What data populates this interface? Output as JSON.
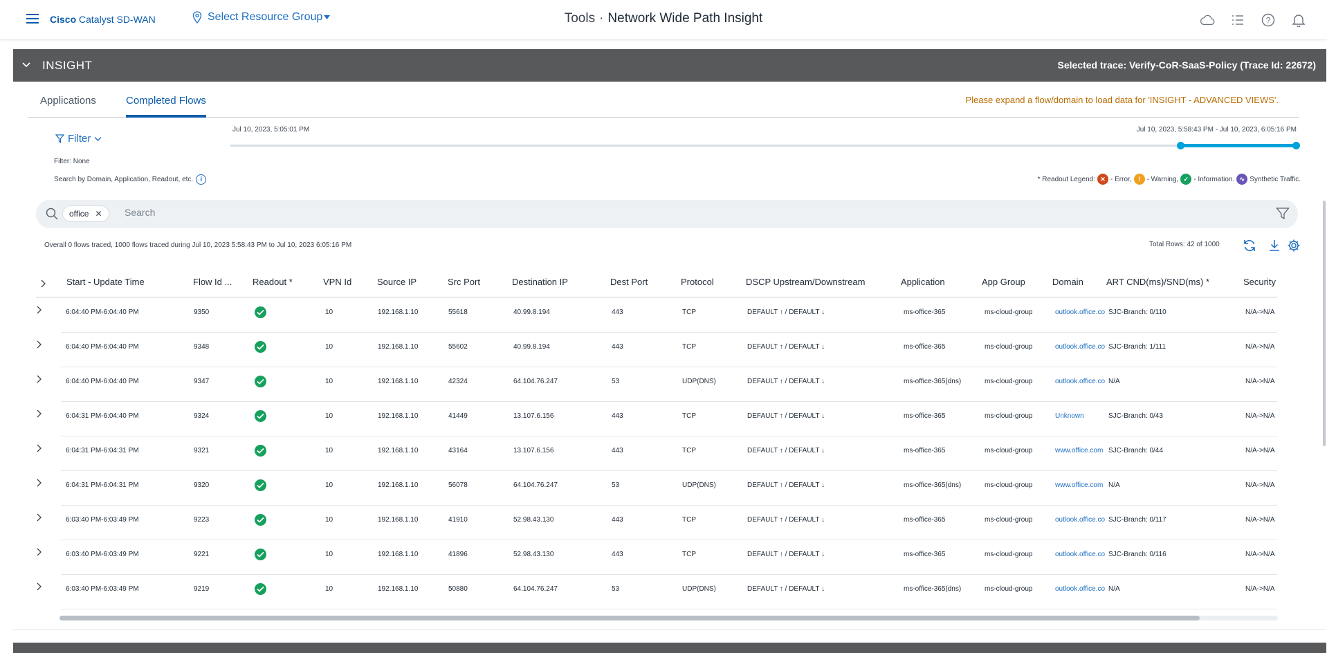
{
  "header": {
    "brand_bold": "Cisco",
    "brand_rest": "Catalyst SD-WAN",
    "resource_group": "Select Resource Group",
    "title_section": "Tools",
    "title_page": "Network Wide Path Insight"
  },
  "insight": {
    "title": "INSIGHT",
    "selected_trace": "Selected trace: Verify-CoR-SaaS-Policy (Trace Id: 22672)"
  },
  "tabs": [
    {
      "label": "Applications",
      "active": false
    },
    {
      "label": "Completed Flows",
      "active": true
    }
  ],
  "notice": "Please expand a flow/domain to load data for 'INSIGHT - ADVANCED VIEWS'.",
  "filter": {
    "label": "Filter",
    "status": "Filter: None",
    "hint": "Search by Domain, Application, Readout, etc."
  },
  "timeline": {
    "start": "Jul 10, 2023, 5:05:01 PM",
    "range": "Jul 10, 2023, 5:58:43 PM - Jul 10, 2023, 6:05:16 PM"
  },
  "legend": {
    "prefix": "* Readout Legend:",
    "error": "- Error,",
    "warning": "- Warning,",
    "information": "- Information.",
    "synthetic": "Synthetic Traffic.",
    "colors": {
      "error": "#d04a1c",
      "warning": "#f0a020",
      "information": "#16a05d",
      "synthetic": "#6b55b8"
    }
  },
  "search": {
    "chip": "office",
    "placeholder": "Search"
  },
  "summary": "Overall 0 flows traced, 1000 flows traced during Jul 10, 2023 5:58:43 PM to Jul 10, 2023 6:05:16 PM",
  "total_rows": "Total Rows: 42 of 1000",
  "table": {
    "headers": [
      "Start - Update Time",
      "Flow Id ...",
      "Readout *",
      "VPN Id",
      "Source IP",
      "Src Port",
      "Destination IP",
      "Dest Port",
      "Protocol",
      "DSCP Upstream/Downstream",
      "Application",
      "App Group",
      "Domain",
      "ART CND(ms)/SND(ms) *",
      "Security"
    ],
    "rows": [
      {
        "time": "6:04:40 PM-6:04:40 PM",
        "flow_id": "9350",
        "vpn": "10",
        "src_ip": "192.168.1.10",
        "src_port": "55618",
        "dst_ip": "40.99.8.194",
        "dst_port": "443",
        "protocol": "TCP",
        "dscp": "DEFAULT ↑ / DEFAULT ↓",
        "app": "ms-office-365",
        "app_group": "ms-cloud-group",
        "domain": "outlook.office.com",
        "art": "SJC-Branch: 0/110",
        "security": "N/A->N/A"
      },
      {
        "time": "6:04:40 PM-6:04:40 PM",
        "flow_id": "9348",
        "vpn": "10",
        "src_ip": "192.168.1.10",
        "src_port": "55602",
        "dst_ip": "40.99.8.194",
        "dst_port": "443",
        "protocol": "TCP",
        "dscp": "DEFAULT ↑ / DEFAULT ↓",
        "app": "ms-office-365",
        "app_group": "ms-cloud-group",
        "domain": "outlook.office.com",
        "art": "SJC-Branch: 1/111",
        "security": "N/A->N/A"
      },
      {
        "time": "6:04:40 PM-6:04:40 PM",
        "flow_id": "9347",
        "vpn": "10",
        "src_ip": "192.168.1.10",
        "src_port": "42324",
        "dst_ip": "64.104.76.247",
        "dst_port": "53",
        "protocol": "UDP(DNS)",
        "dscp": "DEFAULT ↑ / DEFAULT ↓",
        "app": "ms-office-365(dns)",
        "app_group": "ms-cloud-group",
        "domain": "outlook.office.com",
        "art": "N/A",
        "security": "N/A->N/A"
      },
      {
        "time": "6:04:31 PM-6:04:40 PM",
        "flow_id": "9324",
        "vpn": "10",
        "src_ip": "192.168.1.10",
        "src_port": "41449",
        "dst_ip": "13.107.6.156",
        "dst_port": "443",
        "protocol": "TCP",
        "dscp": "DEFAULT ↑ / DEFAULT ↓",
        "app": "ms-office-365",
        "app_group": "ms-cloud-group",
        "domain": "Unknown",
        "art": "SJC-Branch: 0/43",
        "security": "N/A->N/A"
      },
      {
        "time": "6:04:31 PM-6:04:31 PM",
        "flow_id": "9321",
        "vpn": "10",
        "src_ip": "192.168.1.10",
        "src_port": "43164",
        "dst_ip": "13.107.6.156",
        "dst_port": "443",
        "protocol": "TCP",
        "dscp": "DEFAULT ↑ / DEFAULT ↓",
        "app": "ms-office-365",
        "app_group": "ms-cloud-group",
        "domain": "www.office.com",
        "art": "SJC-Branch: 0/44",
        "security": "N/A->N/A"
      },
      {
        "time": "6:04:31 PM-6:04:31 PM",
        "flow_id": "9320",
        "vpn": "10",
        "src_ip": "192.168.1.10",
        "src_port": "56078",
        "dst_ip": "64.104.76.247",
        "dst_port": "53",
        "protocol": "UDP(DNS)",
        "dscp": "DEFAULT ↑ / DEFAULT ↓",
        "app": "ms-office-365(dns)",
        "app_group": "ms-cloud-group",
        "domain": "www.office.com",
        "art": "N/A",
        "security": "N/A->N/A"
      },
      {
        "time": "6:03:40 PM-6:03:49 PM",
        "flow_id": "9223",
        "vpn": "10",
        "src_ip": "192.168.1.10",
        "src_port": "41910",
        "dst_ip": "52.98.43.130",
        "dst_port": "443",
        "protocol": "TCP",
        "dscp": "DEFAULT ↑ / DEFAULT ↓",
        "app": "ms-office-365",
        "app_group": "ms-cloud-group",
        "domain": "outlook.office.com",
        "art": "SJC-Branch: 0/117",
        "security": "N/A->N/A"
      },
      {
        "time": "6:03:40 PM-6:03:49 PM",
        "flow_id": "9221",
        "vpn": "10",
        "src_ip": "192.168.1.10",
        "src_port": "41896",
        "dst_ip": "52.98.43.130",
        "dst_port": "443",
        "protocol": "TCP",
        "dscp": "DEFAULT ↑ / DEFAULT ↓",
        "app": "ms-office-365",
        "app_group": "ms-cloud-group",
        "domain": "outlook.office.com",
        "art": "SJC-Branch: 0/116",
        "security": "N/A->N/A"
      },
      {
        "time": "6:03:40 PM-6:03:49 PM",
        "flow_id": "9219",
        "vpn": "10",
        "src_ip": "192.168.1.10",
        "src_port": "50880",
        "dst_ip": "64.104.76.247",
        "dst_port": "53",
        "protocol": "UDP(DNS)",
        "dscp": "DEFAULT ↑ / DEFAULT ↓",
        "app": "ms-office-365(dns)",
        "app_group": "ms-cloud-group",
        "domain": "outlook.office.com",
        "art": "N/A",
        "security": "N/A->N/A"
      }
    ]
  }
}
